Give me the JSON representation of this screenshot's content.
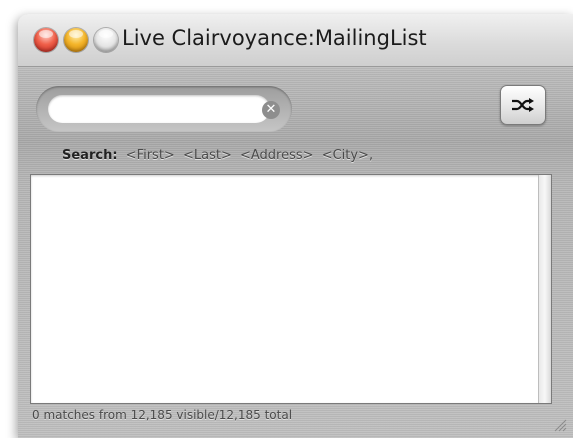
{
  "window": {
    "title": "Live Clairvoyance:MailingList"
  },
  "titlebar_buttons": {
    "close": "close-button",
    "minimize": "minimize-button",
    "zoom": "zoom-button"
  },
  "search": {
    "value": "",
    "placeholder": "",
    "clear_icon": "clear-icon"
  },
  "toolbar": {
    "shuffle_icon": "shuffle-icon"
  },
  "hint": {
    "label": "Search:",
    "fields": [
      "<First>",
      "<Last>",
      "<Address>",
      "<City>,"
    ]
  },
  "results": {
    "items": []
  },
  "status": {
    "text": "0 matches from 12,185 visible/12,185 total"
  },
  "colors": {
    "close": "#e8483a",
    "minimize": "#f2ac24",
    "zoom": "#d9d9d9"
  }
}
